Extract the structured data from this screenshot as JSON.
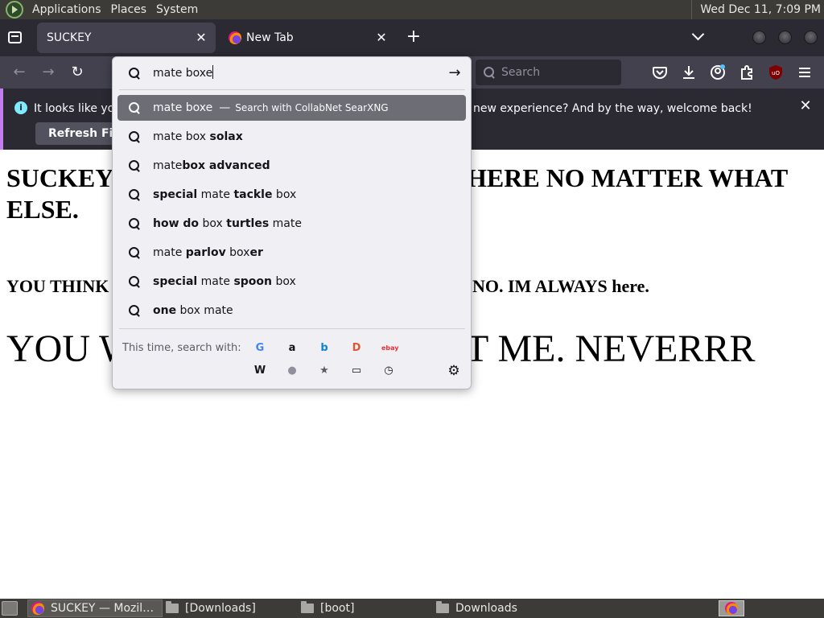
{
  "top_panel": {
    "menus": [
      "Applications",
      "Places",
      "System"
    ],
    "clock": "Wed Dec 11,  7:09 PM"
  },
  "tabs": [
    {
      "title": "SUCKEY",
      "active": true
    },
    {
      "title": "New Tab",
      "active": false
    }
  ],
  "new_tab_symbol": "+",
  "close_symbol": "✕",
  "nav": {
    "back_symbol": "←",
    "forward_symbol": "→",
    "reload_symbol": "↻",
    "search_placeholder": "Search"
  },
  "toolbar_icons": [
    "pocket-icon",
    "downloads-icon",
    "account-icon",
    "extensions-icon",
    "ublock-icon",
    "menu-icon"
  ],
  "notification": {
    "info_symbol": "i",
    "text_left": "It looks like you h",
    "text_right": "new experience? And by the way, welcome back!",
    "button_label": "Refresh Firefox"
  },
  "page": {
    "h1_left": "SUCKEY",
    "h1_right": "HERE NO MATTER WHAT",
    "h1_line2": "ELSE.",
    "h2_left": "YOU THINK",
    "h2_right": "NO. IM ALWAYS here.",
    "big_left": "YOU W",
    "big_right": "T ME. NEVERRR"
  },
  "urlbar": {
    "value": "mate boxe",
    "go_symbol": "→",
    "results": [
      {
        "parts": [
          {
            "t": "mate boxe",
            "b": false
          }
        ],
        "action_sep": "—",
        "action": "Search with CollabNet SearXNG",
        "selected": true
      },
      {
        "parts": [
          {
            "t": "mate box ",
            "b": false
          },
          {
            "t": "solax",
            "b": true
          }
        ]
      },
      {
        "parts": [
          {
            "t": "mate",
            "b": false
          },
          {
            "t": "box advanced",
            "b": true
          }
        ]
      },
      {
        "parts": [
          {
            "t": "special",
            "b": true
          },
          {
            "t": " mate ",
            "b": false
          },
          {
            "t": "tackle",
            "b": true
          },
          {
            "t": " box",
            "b": false
          }
        ]
      },
      {
        "parts": [
          {
            "t": "how do",
            "b": true
          },
          {
            "t": " box ",
            "b": false
          },
          {
            "t": "turtles",
            "b": true
          },
          {
            "t": " mate",
            "b": false
          }
        ]
      },
      {
        "parts": [
          {
            "t": "mate ",
            "b": false
          },
          {
            "t": "parlov",
            "b": true
          },
          {
            "t": " box",
            "b": false
          },
          {
            "t": "er",
            "b": true
          }
        ]
      },
      {
        "parts": [
          {
            "t": "special",
            "b": true
          },
          {
            "t": " mate ",
            "b": false
          },
          {
            "t": "spoon",
            "b": true
          },
          {
            "t": " box",
            "b": false
          }
        ]
      },
      {
        "parts": [
          {
            "t": "one",
            "b": true
          },
          {
            "t": " box mate",
            "b": false
          }
        ]
      }
    ],
    "oneoff_label": "This time, search with:",
    "engines": [
      {
        "name": "google-engine-icon",
        "glyph": "G",
        "color": "#4285f4"
      },
      {
        "name": "amazon-engine-icon",
        "glyph": "a",
        "color": "#15141a"
      },
      {
        "name": "bing-engine-icon",
        "glyph": "b",
        "color": "#0a84d8"
      },
      {
        "name": "duckduckgo-engine-icon",
        "glyph": "D",
        "color": "#de5833"
      },
      {
        "name": "ebay-engine-icon",
        "glyph": "ebay",
        "color": "#e53238"
      },
      {
        "name": "wikipedia-engine-icon",
        "glyph": "W",
        "color": "#15141a"
      },
      {
        "name": "searxng-engine-icon",
        "glyph": "●",
        "color": "#8f8f9d"
      },
      {
        "name": "bookmarks-icon",
        "glyph": "★",
        "color": "#5b5b66"
      },
      {
        "name": "tabs-icon",
        "glyph": "▭",
        "color": "#15141a"
      },
      {
        "name": "history-icon",
        "glyph": "◷",
        "color": "#15141a"
      }
    ],
    "settings_symbol": "⚙"
  },
  "taskbar": {
    "items": [
      {
        "label": "SUCKEY — Mozilla Firefox",
        "active": true,
        "kind": "firefox"
      },
      {
        "label": "[Downloads]",
        "active": false,
        "kind": "folder"
      },
      {
        "label": "[boot]",
        "active": false,
        "kind": "folder"
      },
      {
        "label": "Downloads",
        "active": false,
        "kind": "folder"
      }
    ]
  }
}
